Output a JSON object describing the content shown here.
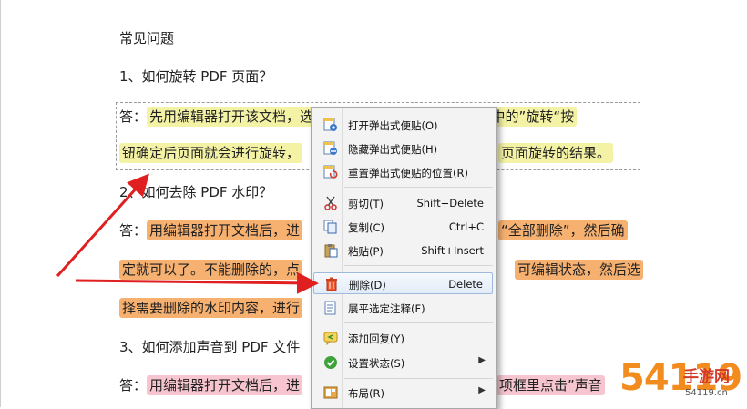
{
  "document": {
    "heading": "常见问题",
    "q1": "1、如何旋转 PDF 页面？",
    "a1_prefix": "答：",
    "a1_line1": "先用编辑器打开该文档，选择“页面操作”选项，在对话框中的”旋转“按",
    "a1_line2_left": "钮确定后页面就会进行旋转，",
    "a1_line2_right": "页面旋转的结果。",
    "q2": "2、如何去除 PDF 水印？",
    "a2_prefix": "答：",
    "a2_line1_left": "用编辑器打开文档后，进",
    "a2_line1_right": "“全部删除”，然后确",
    "a2_line2_left": "定就可以了。不能删除的，点",
    "a2_line2_right": "可编辑状态，然后选",
    "a2_line3_left": "择需要删除的水印内容，进行",
    "q3": "3、如何添加声音到 PDF 文件",
    "a3_prefix": "答：",
    "a3_line1_left": "用编辑器打开文档后，进",
    "a3_line1_right": "项框里点击”声音"
  },
  "context_menu": {
    "items": [
      {
        "label": "打开弹出式便贴(O)",
        "shortcut": "",
        "icon": "note-open-icon"
      },
      {
        "label": "隐藏弹出式便贴(H)",
        "shortcut": "",
        "icon": "note-hide-icon"
      },
      {
        "label": "重置弹出式便贴的位置(R)",
        "shortcut": "",
        "icon": "note-reset-icon"
      },
      {
        "label": "剪切(T)",
        "shortcut": "Shift+Delete",
        "icon": "scissors-icon"
      },
      {
        "label": "复制(C)",
        "shortcut": "Ctrl+C",
        "icon": "copy-icon"
      },
      {
        "label": "粘贴(P)",
        "shortcut": "Shift+Insert",
        "icon": "paste-icon"
      },
      {
        "label": "删除(D)",
        "shortcut": "Delete",
        "icon": "trash-icon"
      },
      {
        "label": "展平选定注释(F)",
        "shortcut": "",
        "icon": "flatten-icon"
      },
      {
        "label": "添加回复(Y)",
        "shortcut": "",
        "icon": "reply-icon"
      },
      {
        "label": "设置状态(S)",
        "shortcut": "",
        "icon": "status-check-icon"
      },
      {
        "label": "布局(R)",
        "shortcut": "",
        "icon": "layout-icon"
      }
    ]
  },
  "watermark": {
    "brand": "54119",
    "name": "手游网",
    "url": "54119.cn"
  },
  "colors": {
    "highlight_yellow": "#f4f2a4",
    "highlight_orange": "#f6b070",
    "highlight_pink": "#f7c5cf",
    "arrow_red": "#e02020",
    "menu_bg": "#f3f3f3"
  }
}
